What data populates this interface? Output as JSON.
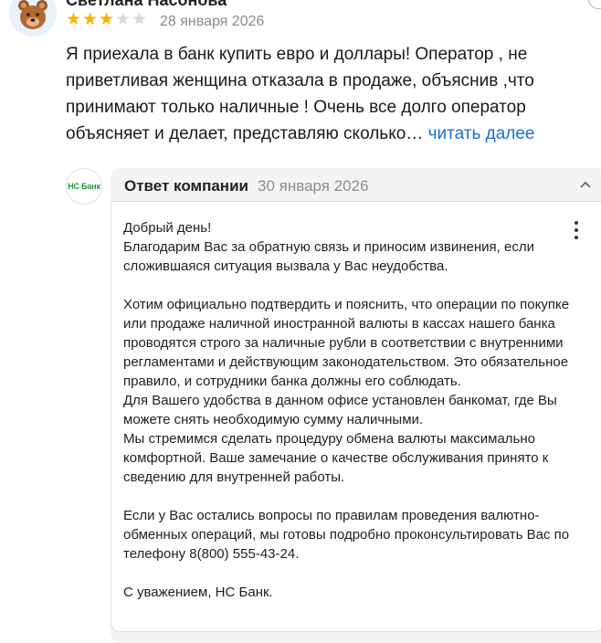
{
  "review": {
    "author": "Светлана Насонова",
    "rating": 3,
    "max_rating": 5,
    "star_color": "#f5b400",
    "star_empty_color": "#d9d9d9",
    "date": "28 января 2026",
    "text": "Я приехала в банк купить евро и доллары! Оператор , не приветливая женщина отказала в продаже, объяснив ,что принимают только наличные ! Очень все долго оператор объясняет и делает, представляю сколько…",
    "read_more": "читать далее"
  },
  "company_reply": {
    "logo_text": "НС Банк",
    "title": "Ответ компании",
    "date": "30 января 2026",
    "paragraphs": [
      "Добрый день!\nБлагодарим Вас за обратную связь и приносим извинения, если сложившаяся ситуация вызвала у Вас неудобства.",
      "Хотим официально подтвердить и пояснить, что операции по покупке или продаже наличной иностранной валюты в кассах нашего банка проводятся строго за наличные рубли в соответствии с внутренними регламентами и действующим законодательством. Это обязательное правило, и сотрудники банка должны его соблюдать.\nДля Вашего удобства в данном офисе установлен банкомат, где Вы можете снять необходимую сумму наличными.\nМы стремимся сделать процедуру обмена валюты максимально комфортной. Ваше замечание о качестве обслуживания принято к сведению для внутренней работы.",
      "Если у Вас остались вопросы по правилам проведения валютно-обменных операций, мы готовы подробно проконсультировать Вас по телефону 8(800) 555-43-24.",
      "С уважением, НС Банк."
    ]
  },
  "colors": {
    "link": "#1a6dd8",
    "muted": "#8c8c8c",
    "reply_header_bg": "#f4f4f4",
    "brand_green": "#2a9a3a"
  }
}
